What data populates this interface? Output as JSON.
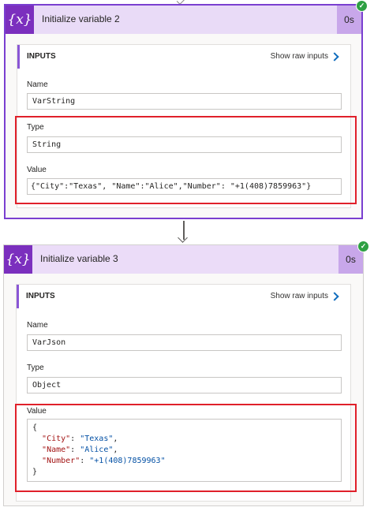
{
  "cards": [
    {
      "title": "Initialize variable 2",
      "duration": "0s",
      "inputs_label": "INPUTS",
      "raw_label": "Show raw inputs",
      "name_label": "Name",
      "name_value": "VarString",
      "type_label": "Type",
      "type_value": "String",
      "value_label": "Value",
      "value_value": "{\"City\":\"Texas\", \"Name\":\"Alice\",\"Number\": \"+1(408)7859963\"}"
    },
    {
      "title": "Initialize variable 3",
      "duration": "0s",
      "inputs_label": "INPUTS",
      "raw_label": "Show raw inputs",
      "name_label": "Name",
      "name_value": "VarJson",
      "type_label": "Type",
      "type_value": "Object",
      "value_label": "Value",
      "json": {
        "open": "{",
        "close": "}",
        "rows": [
          {
            "key": "\"City\"",
            "sep": ": ",
            "val": "\"Texas\"",
            "end": ","
          },
          {
            "key": "\"Name\"",
            "sep": ": ",
            "val": "\"Alice\"",
            "end": ","
          },
          {
            "key": "\"Number\"",
            "sep": ": ",
            "val": "\"+1(408)7859963\"",
            "end": ""
          }
        ]
      }
    }
  ],
  "icons": {
    "variable": "{x}",
    "success": "✓"
  },
  "colors": {
    "header": "#e9dbf7",
    "icon_bg": "#7b2fbe",
    "selected_border": "#7a3fd0",
    "highlight": "#e0202a",
    "success": "#2ea043",
    "link": "#0f6cbd"
  }
}
